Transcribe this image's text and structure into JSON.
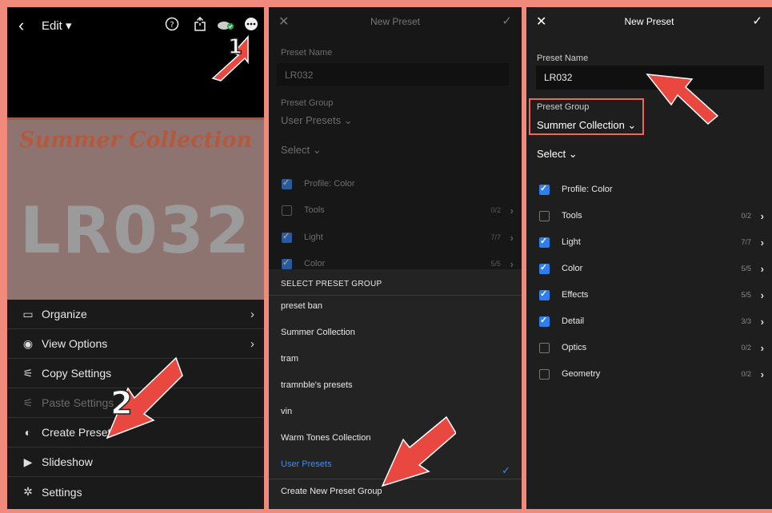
{
  "panel_left": {
    "top_bar": {
      "back_icon": "chevron-left-icon",
      "edit_label": "Edit ▾",
      "help_icon": "help-circle-icon",
      "share_icon": "share-icon",
      "cloud_icon": "cloud-sync-icon",
      "more_icon": "more-horizontal-icon"
    },
    "photo": {
      "title": "Summer Collection",
      "code": "LR032"
    },
    "menu": [
      {
        "label": "Organize",
        "icon": "folder-icon",
        "chevron": "›"
      },
      {
        "label": "View Options",
        "icon": "view-options-icon",
        "chevron": "›"
      },
      {
        "label": "Copy Settings",
        "icon": "copy-settings-icon"
      },
      {
        "label": "Paste Settings",
        "icon": "paste-settings-icon"
      },
      {
        "label": "Create Preset",
        "icon": "create-preset-icon"
      },
      {
        "label": "Slideshow",
        "icon": "play-icon"
      },
      {
        "label": "Settings",
        "icon": "gear-icon"
      }
    ]
  },
  "panel_middle": {
    "header": {
      "close": "✕",
      "title": "New Preset",
      "confirm": "✓"
    },
    "preset_name_label": "Preset Name",
    "preset_name_value": "LR032",
    "preset_group_label": "Preset Group",
    "preset_group_value": "User Presets ⌄",
    "select_label": "Select ⌄",
    "rows": [
      {
        "label": "Profile: Color",
        "checked": true,
        "count": ""
      },
      {
        "label": "Tools",
        "checked": false,
        "count": "0/2"
      },
      {
        "label": "Light",
        "checked": true,
        "count": "7/7"
      },
      {
        "label": "Color",
        "checked": true,
        "count": "5/5"
      }
    ],
    "sheet": {
      "heading": "SELECT PRESET GROUP",
      "options": [
        "preset ban",
        "Summer Collection",
        "tram",
        "tramnble's presets",
        "vin",
        "Warm Tones Collection",
        "User Presets"
      ],
      "selected": "User Presets",
      "check": "✓",
      "create_label": "Create New Preset Group"
    }
  },
  "panel_right": {
    "header": {
      "close": "✕",
      "title": "New Preset",
      "confirm": "✓"
    },
    "preset_name_label": "Preset Name",
    "preset_name_value": "LR032",
    "preset_group_label": "Preset Group",
    "preset_group_value": "Summer Collection ⌄",
    "select_label": "Select ⌄",
    "rows": [
      {
        "label": "Profile: Color",
        "checked": true,
        "count": ""
      },
      {
        "label": "Tools",
        "checked": false,
        "count": "0/2"
      },
      {
        "label": "Light",
        "checked": true,
        "count": "7/7"
      },
      {
        "label": "Color",
        "checked": true,
        "count": "5/5"
      },
      {
        "label": "Effects",
        "checked": true,
        "count": "5/5"
      },
      {
        "label": "Detail",
        "checked": true,
        "count": "3/3"
      },
      {
        "label": "Optics",
        "checked": false,
        "count": "0/2"
      },
      {
        "label": "Geometry",
        "checked": false,
        "count": "0/2"
      }
    ]
  },
  "annotations": {
    "step1": "1",
    "step2": "2"
  },
  "colors": {
    "background": "#f08a7d",
    "accent_blue": "#2d7ff0",
    "arrow_red": "#e8483f"
  }
}
